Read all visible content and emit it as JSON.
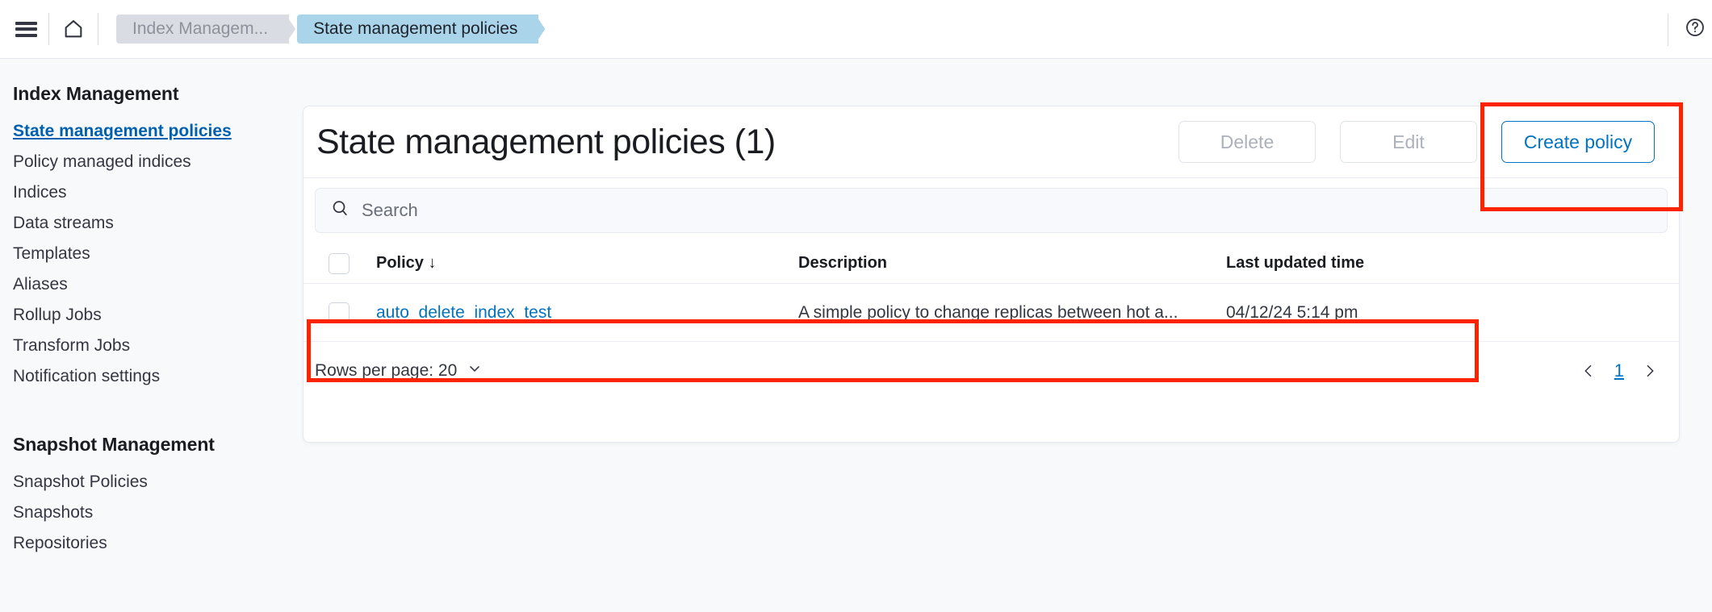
{
  "topbar": {
    "menu_icon": "hamburger-menu-icon",
    "home_icon": "home-icon",
    "help_icon": "help-circle-icon",
    "breadcrumbs": [
      {
        "label": "Index Managem...",
        "active": false
      },
      {
        "label": "State management policies",
        "active": true
      }
    ]
  },
  "sidebar": {
    "sections": [
      {
        "heading": "Index Management",
        "items": [
          {
            "label": "State management policies",
            "active": true
          },
          {
            "label": "Policy managed indices",
            "active": false
          },
          {
            "label": "Indices",
            "active": false
          },
          {
            "label": "Data streams",
            "active": false
          },
          {
            "label": "Templates",
            "active": false
          },
          {
            "label": "Aliases",
            "active": false
          },
          {
            "label": "Rollup Jobs",
            "active": false
          },
          {
            "label": "Transform Jobs",
            "active": false
          },
          {
            "label": "Notification settings",
            "active": false
          }
        ]
      },
      {
        "heading": "Snapshot Management",
        "items": [
          {
            "label": "Snapshot Policies",
            "active": false
          },
          {
            "label": "Snapshots",
            "active": false
          },
          {
            "label": "Repositories",
            "active": false
          }
        ]
      }
    ]
  },
  "panel": {
    "title": "State management policies (1)",
    "actions": {
      "delete_label": "Delete",
      "edit_label": "Edit",
      "create_label": "Create policy"
    },
    "search": {
      "placeholder": "Search",
      "value": "",
      "icon": "search-icon"
    },
    "table": {
      "columns": [
        {
          "label": "Policy",
          "sort": "↓"
        },
        {
          "label": "Description",
          "sort": ""
        },
        {
          "label": "Last updated time",
          "sort": ""
        }
      ],
      "rows": [
        {
          "policy": "auto_delete_index_test",
          "description": "A simple policy to change replicas between hot a...",
          "last_updated": "04/12/24 5:14 pm"
        }
      ]
    },
    "footer": {
      "rows_per_page_label": "Rows per page: 20",
      "chevron_icon": "chevron-down-icon",
      "prev_icon": "chevron-left-icon",
      "next_icon": "chevron-right-icon",
      "current_page": "1"
    }
  },
  "colors": {
    "accent": "#0073c2",
    "annotation": "#fc2400",
    "crumb_active_bg": "#a9d4ea",
    "crumb_inactive_bg": "#d9dce2",
    "page_bg": "#f8f9fb"
  }
}
